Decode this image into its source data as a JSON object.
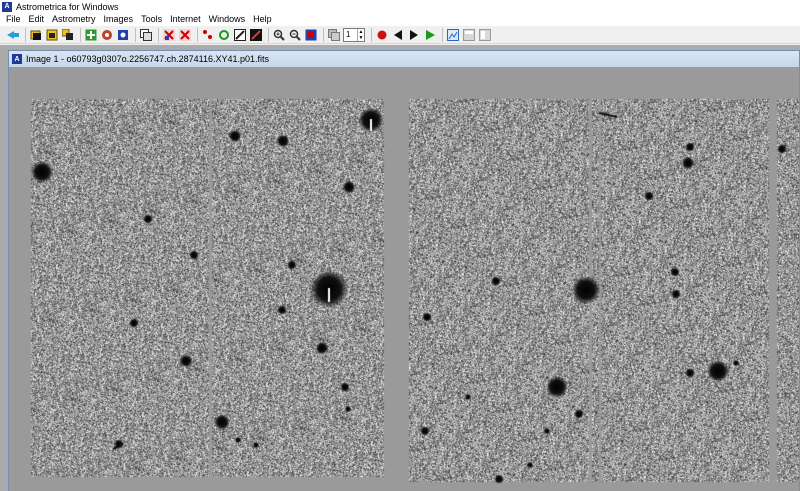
{
  "app": {
    "title": "Astrometrica for Windows",
    "icon": "app-logo-icon"
  },
  "menu": [
    {
      "label": "File",
      "name": "menu-file"
    },
    {
      "label": "Edit",
      "name": "menu-edit"
    },
    {
      "label": "Astrometry",
      "name": "menu-astrometry"
    },
    {
      "label": "Images",
      "name": "menu-images"
    },
    {
      "label": "Tools",
      "name": "menu-tools"
    },
    {
      "label": "Internet",
      "name": "menu-internet"
    },
    {
      "label": "Windows",
      "name": "menu-windows"
    },
    {
      "label": "Help",
      "name": "menu-help"
    }
  ],
  "toolbar": {
    "frame_counter": "1",
    "colors": {
      "red": "#cc1111",
      "green": "#1a9a1a",
      "black": "#111111",
      "accent": "#2266cc"
    }
  },
  "image_window": {
    "title": "Image 1 - o60793g0307o.2256747.ch.2874116.XY41.p01.fits",
    "background_color": "#9a9a9a"
  }
}
